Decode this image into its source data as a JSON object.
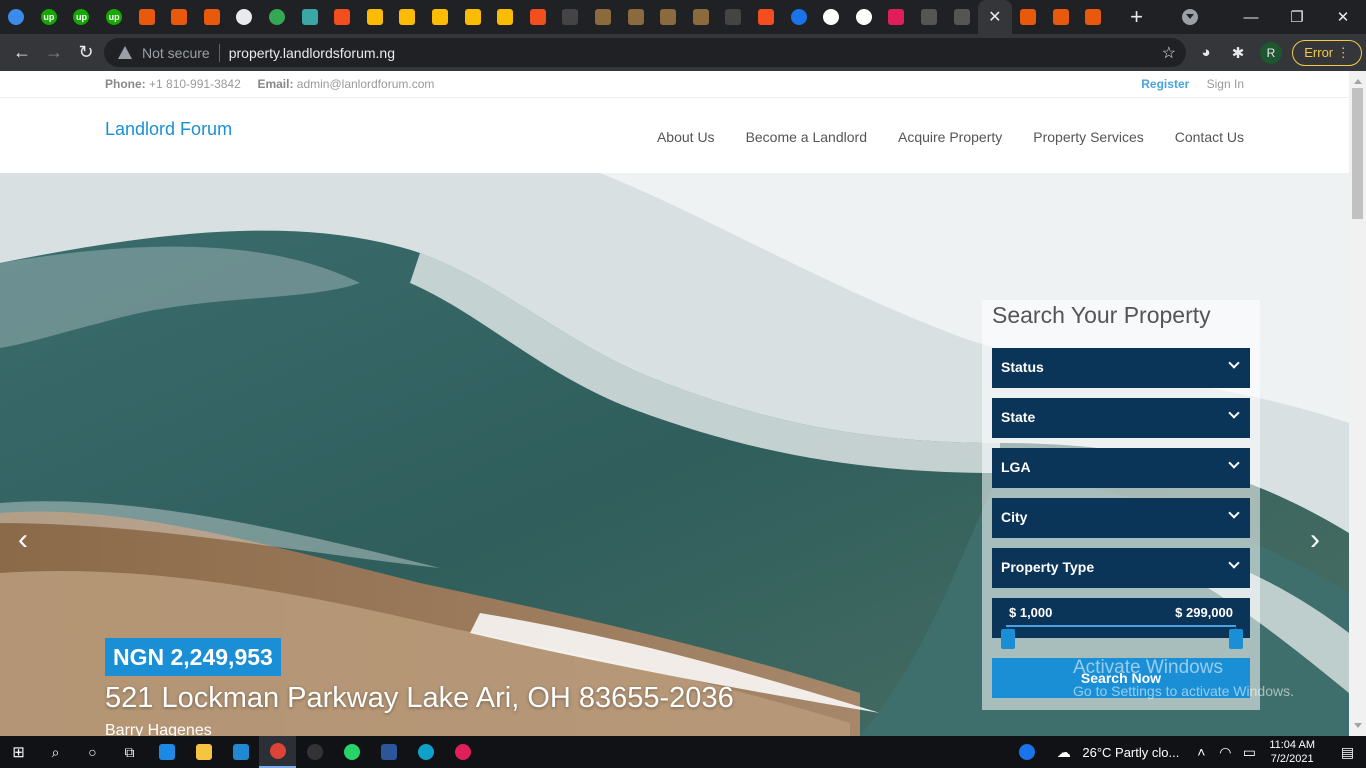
{
  "browser": {
    "tabs": [
      {
        "icon": "circle-icon",
        "color": "#3b8beb"
      },
      {
        "icon": "upwork-icon",
        "color": "#14a800",
        "text": "up"
      },
      {
        "icon": "upwork-icon",
        "color": "#14a800",
        "text": "up"
      },
      {
        "icon": "upwork-icon",
        "color": "#14a800",
        "text": "up"
      },
      {
        "icon": "link-icon",
        "color": "#e8590c"
      },
      {
        "icon": "link-icon",
        "color": "#e8590c"
      },
      {
        "icon": "link-icon",
        "color": "#e8590c"
      },
      {
        "icon": "github-icon",
        "color": "#e8eaed"
      },
      {
        "icon": "globe-icon",
        "color": "#34a853"
      },
      {
        "icon": "panel-icon",
        "color": "#3aa6a6"
      },
      {
        "icon": "figma-icon",
        "color": "#f24e1e"
      },
      {
        "icon": "drive-icon",
        "color": "#fbbc04"
      },
      {
        "icon": "drive-icon",
        "color": "#fbbc04"
      },
      {
        "icon": "drive-icon",
        "color": "#fbbc04"
      },
      {
        "icon": "drive-icon",
        "color": "#fbbc04"
      },
      {
        "icon": "drive-icon",
        "color": "#fbbc04"
      },
      {
        "icon": "figma-icon",
        "color": "#f24e1e"
      },
      {
        "icon": "dark-app-icon",
        "color": "#444"
      },
      {
        "icon": "flag-icon",
        "color": "#8b6a3e"
      },
      {
        "icon": "flag-icon",
        "color": "#8b6a3e"
      },
      {
        "icon": "flag-icon",
        "color": "#8b6a3e"
      },
      {
        "icon": "flag-icon",
        "color": "#8b6a3e"
      },
      {
        "icon": "dark-app-icon",
        "color": "#444"
      },
      {
        "icon": "figma-icon",
        "color": "#f24e1e"
      },
      {
        "icon": "info-icon",
        "color": "#1a73e8"
      },
      {
        "icon": "google-icon",
        "color": "#ffffff"
      },
      {
        "icon": "google-icon",
        "color": "#ffffff"
      },
      {
        "icon": "slack-icon",
        "color": "#e01e5a"
      },
      {
        "icon": "box-icon",
        "color": "#555"
      },
      {
        "icon": "box-icon",
        "color": "#555"
      }
    ],
    "tabs_after": [
      {
        "icon": "link-icon",
        "color": "#e8590c"
      },
      {
        "icon": "link-icon",
        "color": "#e8590c"
      },
      {
        "icon": "link-icon",
        "color": "#e8590c"
      }
    ],
    "not_secure": "Not secure",
    "url": "property.landlordsforum.ng",
    "profile_initial": "R",
    "error_label": "Error"
  },
  "site": {
    "topbar": {
      "phone_label": "Phone:",
      "phone": "+1 810-991-3842",
      "email_label": "Email:",
      "email": "admin@lanlordforum.com",
      "register": "Register",
      "signin": "Sign In"
    },
    "brand": "Landlord Forum",
    "nav": [
      "About Us",
      "Become a Landlord",
      "Acquire Property",
      "Property Services",
      "Contact Us"
    ]
  },
  "hero": {
    "price": "NGN 2,249,953",
    "address": "521 Lockman Parkway Lake Ari, OH 83655-2036",
    "agent": "Barry Hagenes"
  },
  "search": {
    "title": "Search Your Property",
    "selects": [
      "Status",
      "State",
      "LGA",
      "City",
      "Property Type"
    ],
    "range_min": "$ 1,000",
    "range_max": "$ 299,000",
    "button": "Search Now"
  },
  "watermark": {
    "line1": "Activate Windows",
    "line2": "Go to Settings to activate Windows."
  },
  "taskbar": {
    "weather": "26°C  Partly clo...",
    "time": "11:04 AM",
    "date": "7/2/2021"
  }
}
